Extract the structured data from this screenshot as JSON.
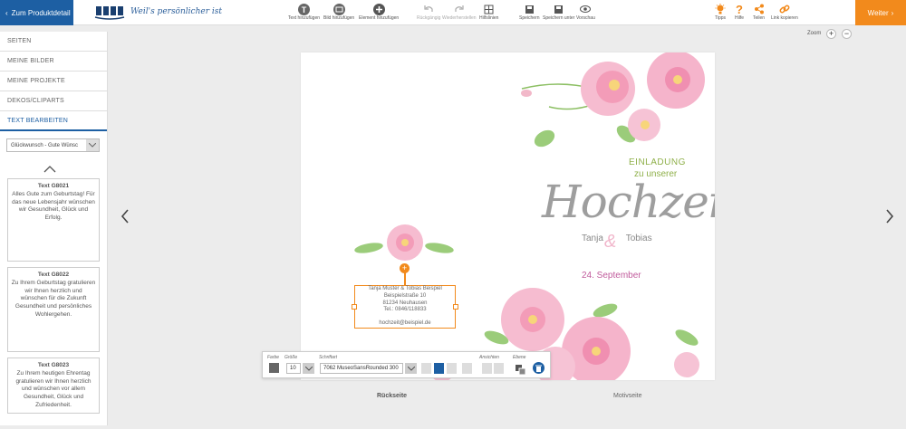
{
  "topbar": {
    "back_label": "Zum Produktdetail",
    "slogan": "Weil's persönlicher ist",
    "tools": [
      {
        "label": "Text hinzufügen",
        "icon": "text-add-icon"
      },
      {
        "label": "Bild hinzufügen",
        "icon": "image-add-icon"
      },
      {
        "label": "Element hinzufügen",
        "icon": "element-add-icon"
      },
      {
        "label": "Rückgängig",
        "icon": "undo-icon"
      },
      {
        "label": "Wiederherstellen",
        "icon": "redo-icon"
      },
      {
        "label": "Hilfslinien",
        "icon": "grid-icon"
      },
      {
        "label": "Speichern",
        "icon": "save-icon"
      },
      {
        "label": "Speichern unter",
        "icon": "save-as-icon"
      },
      {
        "label": "Vorschau",
        "icon": "preview-icon"
      },
      {
        "label": "Tipps",
        "icon": "lightbulb-icon"
      },
      {
        "label": "Hilfe",
        "icon": "help-icon"
      },
      {
        "label": "Teilen",
        "icon": "share-icon"
      },
      {
        "label": "Link kopieren",
        "icon": "link-icon"
      }
    ],
    "next_label": "Weiter"
  },
  "sidebar": {
    "items": [
      "SEITEN",
      "MEINE BILDER",
      "MEINE PROJEKTE",
      "DEKOS/CLIPARTS",
      "TEXT BEARBEITEN"
    ],
    "category_select": "Glückwunsch - Gute Wünsc",
    "texts": [
      {
        "title": "Text G8021",
        "body": "Alles Gute zum Geburtstag! Für das neue Lebensjahr wünschen wir Gesundheit, Glück und Erfolg."
      },
      {
        "title": "Text G8022",
        "body": "Zu Ihrem Geburtstag gratulieren wir Ihnen herzlich und wünschen für die Zukunft Gesundheit und persönliches Wohlergehen."
      },
      {
        "title": "Text G8023",
        "body": "Zu Ihrem heutigen Ehrentag gratulieren wir Ihnen herzlich und wünschen vor allem Gesundheit, Glück und Zufriedenheit."
      }
    ]
  },
  "zoom": {
    "label": "Zoom",
    "plus": "+",
    "minus": "−"
  },
  "card": {
    "einladung": "EINLADUNG",
    "zu_unserer": "zu unserer",
    "hochzeit": "Hochzeit",
    "name1": "Tanja",
    "amp": "&",
    "name2": "Tobias",
    "date": "24. September",
    "address": {
      "line1": "Tanja Muster & Tobias Beispiel",
      "line2": "Beispielstraße 10",
      "line3": "81234 Neuhausen",
      "line4": "Tel.: 0846/118833",
      "line5": "hochzeit@beispiel.de"
    }
  },
  "pages": {
    "left": "Rückseite",
    "right": "Motivseite"
  },
  "text_toolbar": {
    "farbe": "Farbe",
    "groesse": "Größe",
    "size_value": "10",
    "schriftart": "Schriftart",
    "font_value": "7062 MuseoSansRounded 300",
    "ansichten": "Ansichten",
    "ebene": "Ebene"
  },
  "colors": {
    "primary": "#1d5fa3",
    "accent": "#f28a1c",
    "green": "#8fb04a",
    "pink": "#c05a9b"
  }
}
